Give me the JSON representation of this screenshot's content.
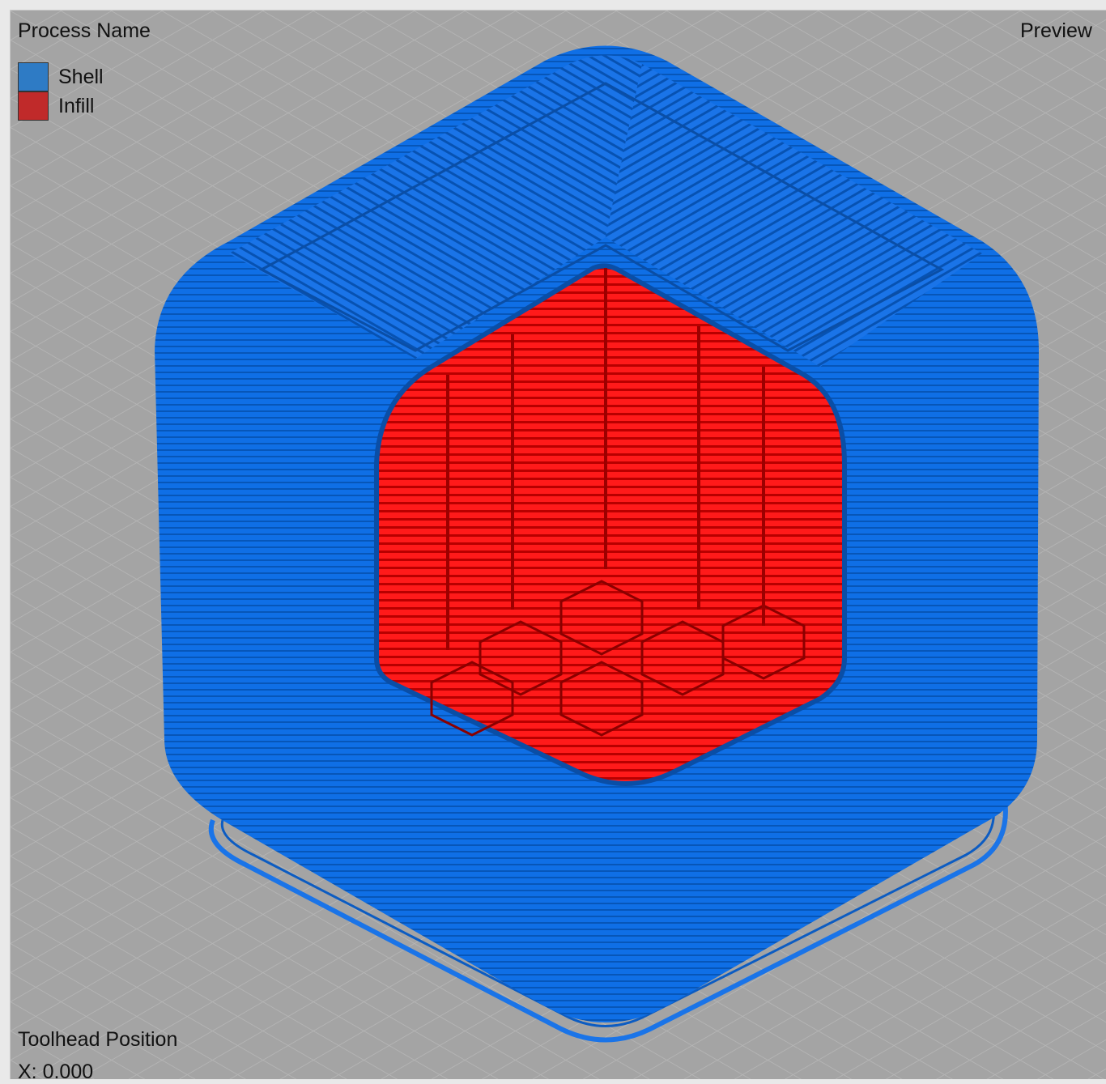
{
  "legend": {
    "title": "Process Name",
    "items": [
      {
        "label": "Shell",
        "color": "#2e7bc5"
      },
      {
        "label": "Infill",
        "color": "#c02a2a"
      }
    ]
  },
  "view_mode_label": "Preview",
  "toolhead": {
    "title": "Toolhead Position",
    "x_readout": "X: 0.000"
  },
  "colors": {
    "background": "#a4a4a4",
    "grid_line": "#b5b5b5",
    "shell": "#0f6fe6",
    "shell_dark": "#0756b8",
    "infill": "#ff1a1a",
    "infill_dark": "#b00000"
  }
}
